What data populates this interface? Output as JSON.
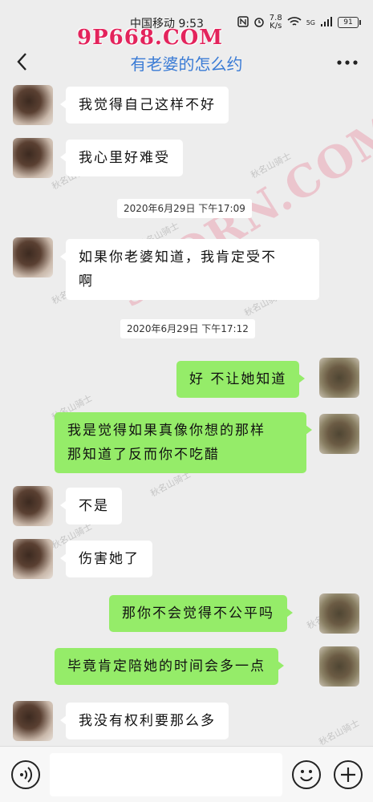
{
  "status_bar": {
    "carrier_time": "中国移动 9:53",
    "netspeed_value": "7.8",
    "netspeed_unit": "K/s",
    "network": "5G",
    "battery": "91"
  },
  "watermark": {
    "logo": "9P668.COM",
    "overlay": "9PORN.COM",
    "repeated": "秋名山骑士"
  },
  "header": {
    "title": "有老婆的怎么约"
  },
  "messages": [
    {
      "side": "left",
      "text": "我觉得自己这样不好"
    },
    {
      "side": "left",
      "text": "我心里好难受"
    },
    {
      "type": "time",
      "text": "2020年6月29日 下午17:09"
    },
    {
      "side": "left",
      "lines": [
        "如果你老婆知道，我肯定受不",
        "啊"
      ]
    },
    {
      "type": "time",
      "text": "2020年6月29日 下午17:12"
    },
    {
      "side": "right",
      "text": "好 不让她知道"
    },
    {
      "side": "right",
      "lines": [
        "我是觉得如果真像你想的那样",
        "那知道了反而你不吃醋"
      ]
    },
    {
      "side": "left",
      "text": "不是"
    },
    {
      "side": "left",
      "text": "伤害她了"
    },
    {
      "side": "right",
      "text": "那你不会觉得不公平吗"
    },
    {
      "side": "right",
      "text": "毕竟肯定陪她的时间会多一点"
    },
    {
      "side": "left",
      "text": "我没有权利要那么多"
    }
  ],
  "colors": {
    "background": "#ededed",
    "bubble_right": "#95ec69",
    "bubble_left": "#ffffff",
    "title": "#3a7bd5"
  },
  "icons": {
    "back": "chevron-left-icon",
    "more": "more-dots-icon",
    "voice": "voice-icon",
    "emoji": "emoji-icon",
    "plus": "plus-icon"
  }
}
